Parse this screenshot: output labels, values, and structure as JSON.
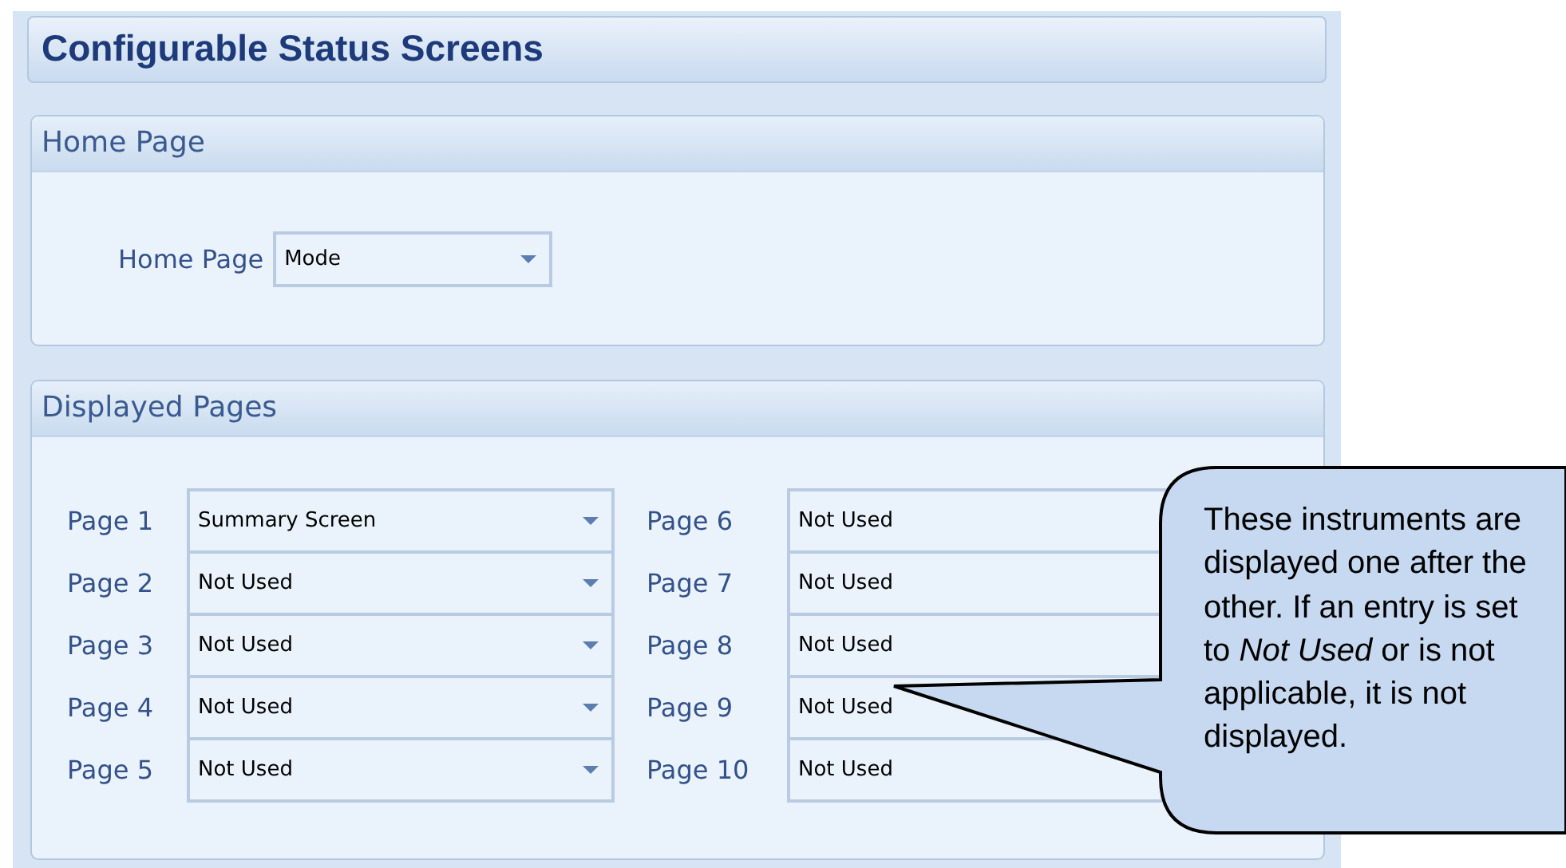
{
  "title": "Configurable Status Screens",
  "home_page": {
    "heading": "Home Page",
    "label": "Home Page",
    "value": "Mode"
  },
  "displayed_pages": {
    "heading": "Displayed Pages",
    "columns": [
      {
        "pages": [
          {
            "label": "Page 1",
            "value": "Summary Screen"
          },
          {
            "label": "Page 2",
            "value": "Not Used"
          },
          {
            "label": "Page 3",
            "value": "Not Used"
          },
          {
            "label": "Page 4",
            "value": "Not Used"
          },
          {
            "label": "Page 5",
            "value": "Not Used"
          }
        ]
      },
      {
        "pages": [
          {
            "label": "Page 6",
            "value": "Not Used"
          },
          {
            "label": "Page 7",
            "value": "Not Used"
          },
          {
            "label": "Page 8",
            "value": "Not Used"
          },
          {
            "label": "Page 9",
            "value": "Not Used"
          },
          {
            "label": "Page 10",
            "value": "Not Used"
          }
        ]
      }
    ]
  },
  "callout": {
    "text": "These instruments are displayed one after the other. If an entry is set to *Not Used* or is not applicable, it is not displayed."
  }
}
